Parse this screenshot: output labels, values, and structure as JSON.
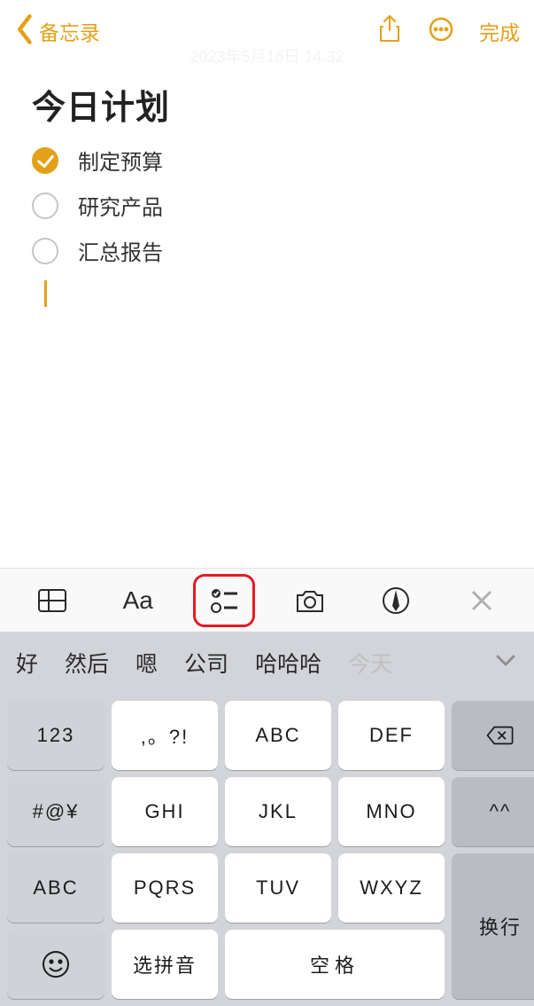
{
  "header": {
    "back_label": "备忘录",
    "done_label": "完成",
    "date_faint": "2023年5月16日 14:32"
  },
  "note": {
    "title": "今日计划",
    "items": [
      {
        "text": "制定预算",
        "checked": true
      },
      {
        "text": "研究产品",
        "checked": false
      },
      {
        "text": "汇总报告",
        "checked": false
      }
    ]
  },
  "format_bar": {
    "aa_label": "Aa"
  },
  "candidates": [
    "好",
    "然后",
    "嗯",
    "公司",
    "哈哈哈",
    "今天"
  ],
  "keys": {
    "r1": [
      "123",
      ",。?!",
      "ABC",
      "DEF"
    ],
    "r2": [
      "#@¥",
      "GHI",
      "JKL",
      "MNO",
      "^^"
    ],
    "r3": [
      "ABC",
      "PQRS",
      "TUV",
      "WXYZ"
    ],
    "enter": "换行",
    "ime": "选拼音",
    "space": "空格"
  }
}
